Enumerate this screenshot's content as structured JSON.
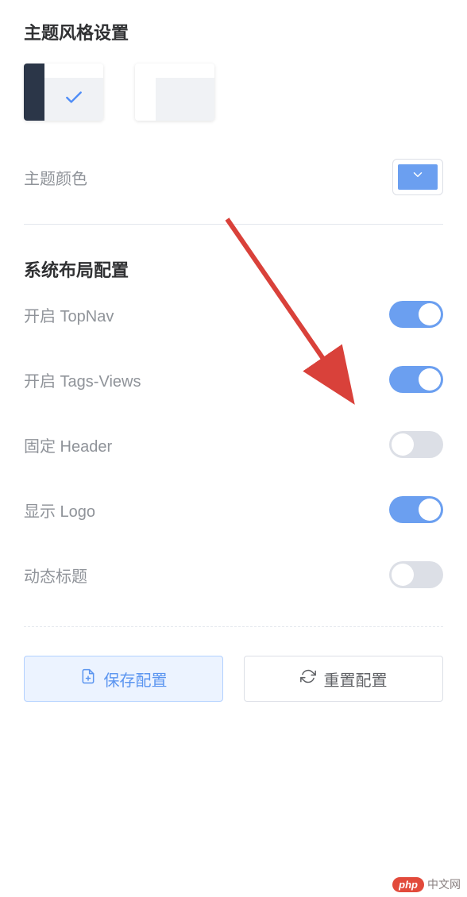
{
  "theme": {
    "title": "主题风格设置",
    "options": [
      {
        "id": "dark-sidebar",
        "selected": true
      },
      {
        "id": "light-sidebar",
        "selected": false
      }
    ]
  },
  "color": {
    "label": "主题颜色",
    "value": "#6b9ff0"
  },
  "layout": {
    "title": "系统布局配置",
    "items": [
      {
        "label": "开启 TopNav",
        "on": true
      },
      {
        "label": "开启 Tags-Views",
        "on": true
      },
      {
        "label": "固定 Header",
        "on": false
      },
      {
        "label": "显示 Logo",
        "on": true
      },
      {
        "label": "动态标题",
        "on": false
      }
    ]
  },
  "actions": {
    "save": "保存配置",
    "reset": "重置配置"
  },
  "annotation": {
    "type": "arrow",
    "color": "#d9413a"
  },
  "watermark": {
    "badge": "php",
    "text": "中文网"
  }
}
